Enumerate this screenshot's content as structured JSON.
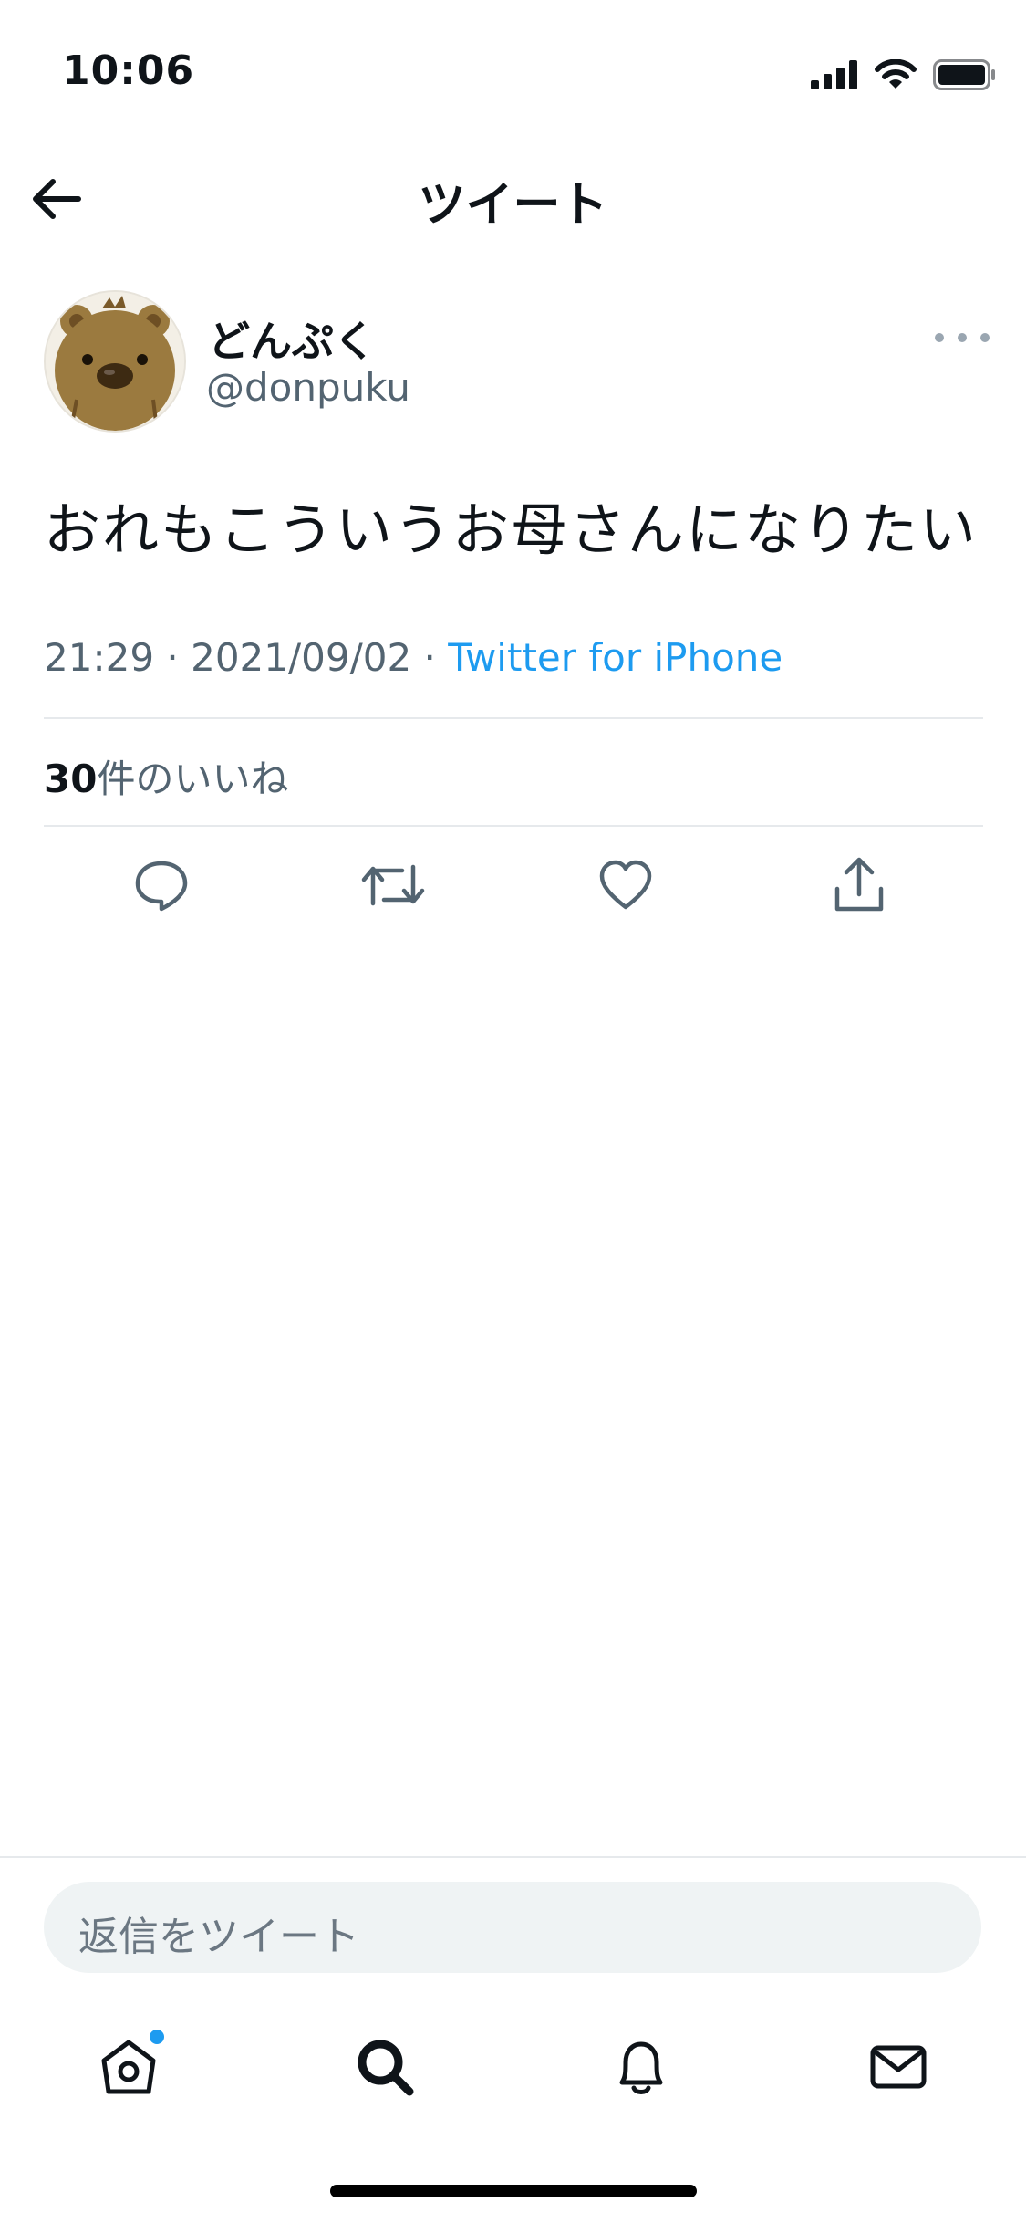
{
  "status_bar": {
    "time": "10:06"
  },
  "header": {
    "title": "ツイート"
  },
  "tweet": {
    "display_name": "どんぷく",
    "handle": "@donpuku",
    "text": "おれもこういうお母さんになりたい",
    "time": "21:29",
    "date": "2021/09/02",
    "separator": " · ",
    "source": "Twitter for iPhone",
    "likes_count": "30",
    "likes_label": "件のいいね"
  },
  "reply": {
    "placeholder": "返信をツイート"
  },
  "colors": {
    "accent": "#1d9bf0",
    "text_primary": "#0f1419",
    "text_secondary": "#536471",
    "divider": "#e6e9ec"
  },
  "icons": {
    "actions": [
      "reply-icon",
      "retweet-icon",
      "like-icon",
      "share-icon"
    ],
    "tabs": [
      "home-icon",
      "search-icon",
      "notifications-icon",
      "messages-icon"
    ]
  }
}
